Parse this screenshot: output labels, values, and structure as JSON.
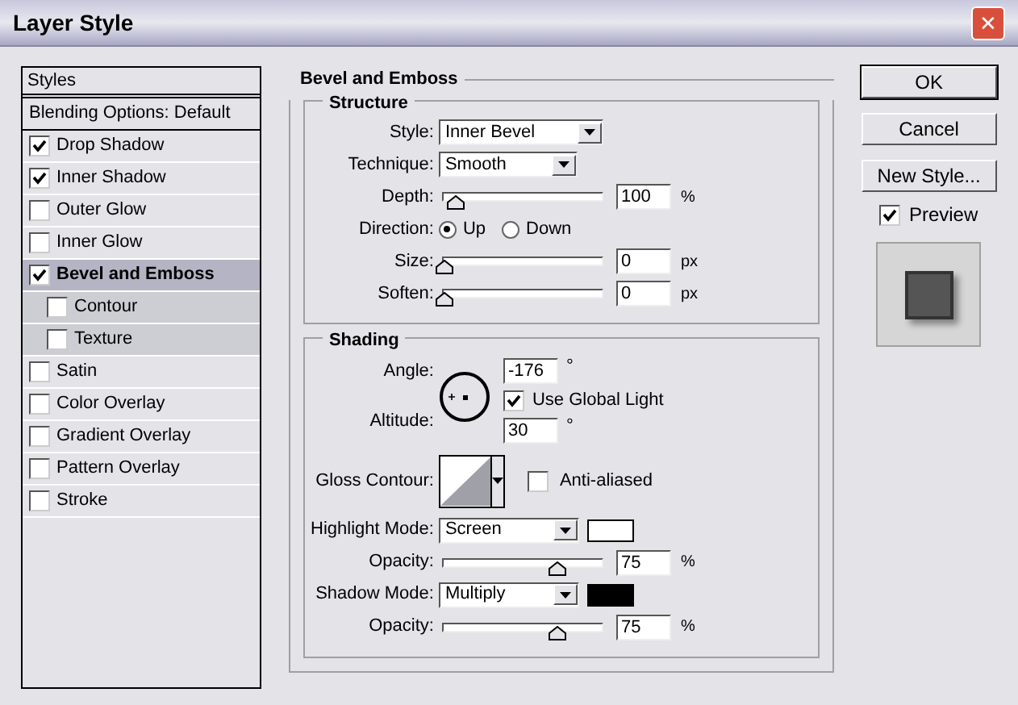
{
  "window": {
    "title": "Layer Style",
    "close": "✕"
  },
  "styles": {
    "header": "Styles",
    "items": [
      {
        "kind": "option",
        "label": "Blending Options: Default",
        "selected": false
      },
      {
        "kind": "effect",
        "label": "Drop Shadow",
        "checked": true,
        "selected": false
      },
      {
        "kind": "effect",
        "label": "Inner Shadow",
        "checked": true,
        "selected": false
      },
      {
        "kind": "effect",
        "label": "Outer Glow",
        "checked": false,
        "selected": false
      },
      {
        "kind": "effect",
        "label": "Inner Glow",
        "checked": false,
        "selected": false
      },
      {
        "kind": "effect",
        "label": "Bevel and Emboss",
        "checked": true,
        "selected": true
      },
      {
        "kind": "sub",
        "label": "Contour",
        "checked": false,
        "selected": false
      },
      {
        "kind": "sub",
        "label": "Texture",
        "checked": false,
        "selected": false
      },
      {
        "kind": "effect",
        "label": "Satin",
        "checked": false,
        "selected": false
      },
      {
        "kind": "effect",
        "label": "Color Overlay",
        "checked": false,
        "selected": false
      },
      {
        "kind": "effect",
        "label": "Gradient Overlay",
        "checked": false,
        "selected": false
      },
      {
        "kind": "effect",
        "label": "Pattern Overlay",
        "checked": false,
        "selected": false
      },
      {
        "kind": "effect",
        "label": "Stroke",
        "checked": false,
        "selected": false
      }
    ]
  },
  "panel": {
    "title": "Bevel and Emboss",
    "structure": {
      "title": "Structure",
      "rows": [
        {
          "kind": "dropdown",
          "label": "Style:",
          "value": "Inner Bevel"
        },
        {
          "kind": "dropdown",
          "label": "Technique:",
          "value": "Smooth"
        },
        {
          "kind": "slider",
          "label": "Depth:",
          "level": 0.08,
          "value": "100",
          "unit": "%"
        },
        {
          "kind": "radio",
          "label": "Direction:",
          "options": [
            {
              "label": "Up",
              "selected": true
            },
            {
              "label": "Down",
              "selected": false
            }
          ]
        },
        {
          "kind": "slider",
          "label": "Size:",
          "level": 0,
          "value": "0",
          "unit": "px"
        },
        {
          "kind": "slider",
          "label": "Soften:",
          "level": 0,
          "value": "0",
          "unit": "px"
        }
      ]
    },
    "shading": {
      "title": "Shading",
      "angle_label": "Angle:",
      "angle": "-176",
      "angle_unit": "°",
      "global_light": {
        "label": "Use Global Light",
        "checked": true
      },
      "altitude_label": "Altitude:",
      "altitude": "30",
      "altitude_unit": "°",
      "gloss_label": "Gloss Contour:",
      "anti_aliased": {
        "label": "Anti-aliased",
        "checked": false
      },
      "rows": [
        {
          "kind": "mode",
          "label": "Highlight Mode:",
          "value": "Screen",
          "color": "#ffffff"
        },
        {
          "kind": "slider",
          "label": "Opacity:",
          "level": 0.75,
          "value": "75",
          "unit": "%"
        },
        {
          "kind": "mode",
          "label": "Shadow Mode:",
          "value": "Multiply",
          "color": "#000000"
        },
        {
          "kind": "slider",
          "label": "Opacity:",
          "level": 0.75,
          "value": "75",
          "unit": "%"
        }
      ]
    }
  },
  "buttons": [
    {
      "label": "OK",
      "default": true
    },
    {
      "label": "Cancel",
      "default": false
    },
    {
      "label": "New Style...",
      "default": false
    }
  ],
  "preview": {
    "label": "Preview",
    "checked": true
  }
}
